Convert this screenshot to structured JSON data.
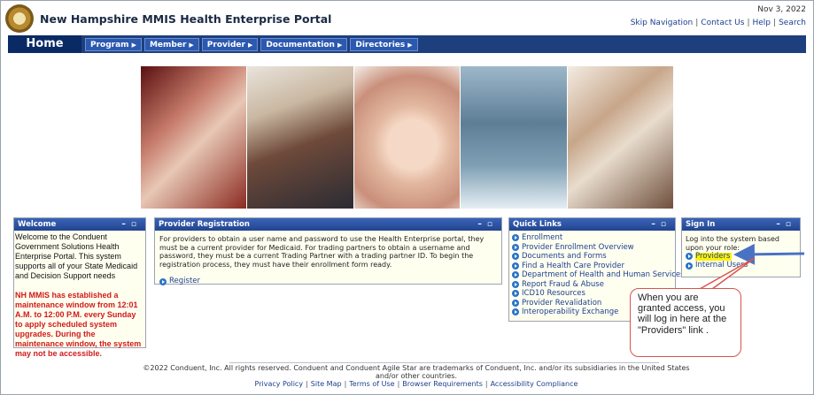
{
  "header": {
    "title": "New Hampshire MMIS Health Enterprise Portal",
    "date": "Nov 3, 2022",
    "links": [
      "Skip Navigation",
      "Contact Us",
      "Help",
      "Search"
    ]
  },
  "nav": {
    "home": "Home",
    "menu": [
      "Program",
      "Member",
      "Provider",
      "Documentation",
      "Directories"
    ]
  },
  "welcome": {
    "title": "Welcome",
    "text": "Welcome to the Conduent Government Solutions Health Enterprise Portal. This system supports all of your State Medicaid and Decision Support needs",
    "alert": "NH MMIS has established a maintenance window from 12:01 A.M. to 12:00 P.M. every Sunday to apply scheduled system upgrades. During the maintenance window, the system may not be accessible."
  },
  "provider_registration": {
    "title": "Provider Registration",
    "text": "For providers to obtain a user name and password to use the Health Enterprise portal, they must be a current provider for Medicaid. For trading partners to obtain a username and password, they must be a current Trading Partner with a trading partner ID. To begin the registration process, they must have their enrollment form ready.",
    "register": "Register"
  },
  "quick_links": {
    "title": "Quick Links",
    "items": [
      "Enrollment",
      "Provider Enrollment Overview",
      "Documents and Forms",
      "Find a Health Care Provider",
      "Department of Health and Human Services",
      "Report Fraud & Abuse",
      "ICD10 Resources",
      "Provider Revalidation",
      "Interoperability Exchange"
    ]
  },
  "sign_in": {
    "title": "Sign In",
    "text": "Log into the system based upon your role:",
    "providers": "Providers",
    "internal": "Internal Users"
  },
  "callout": {
    "text": "When you are granted access, you will log in here at the \"Providers\" link ."
  },
  "footer": {
    "copyright": "©2022 Conduent, Inc. All rights reserved. Conduent and Conduent Agile Star are trademarks of Conduent, Inc. and/or its subsidiaries in the United States and/or other countries.",
    "links": [
      "Privacy Policy",
      "Site Map",
      "Terms of Use",
      "Browser Requirements",
      "Accessibility Compliance"
    ]
  },
  "colors": {
    "nav": "#1d3f7e",
    "link": "#1c3f8f",
    "alert": "#d11a1a",
    "highlight": "#fff200",
    "callout_border": "#d9534f",
    "arrow": "#4a72c4"
  }
}
